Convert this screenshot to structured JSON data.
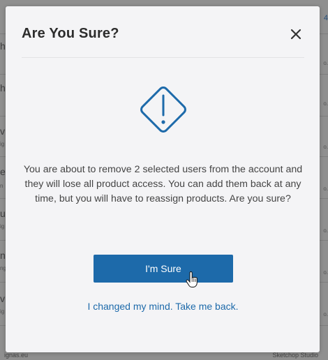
{
  "background": {
    "right_top_text": "4",
    "left_labels": [
      "h",
      "h",
      "v",
      "e",
      "u",
      "n",
      "v"
    ],
    "left_sublabels": [
      "",
      "",
      "ig",
      "n",
      "ig",
      "ng",
      "ig"
    ],
    "right_labels": [
      "o.",
      "o.",
      "o.",
      "o.",
      "o.",
      "o.",
      "o."
    ],
    "bottom_left": "ignas.eu",
    "bottom_right": "Sketchop Studio"
  },
  "modal": {
    "title": "Are You Sure?",
    "message": "You are about to remove 2 selected users from the account and they will lose all product access. You can add them back at any time, but you will have to reassign products. Are you sure?",
    "confirm_label": "I'm Sure",
    "cancel_label": "I changed my mind. Take me back."
  },
  "icons": {
    "close": "close-icon",
    "alert": "warning-diamond-icon",
    "cursor": "hand-pointer-icon"
  },
  "colors": {
    "accent": "#1d6aaa",
    "modal_bg": "#f4f4f6",
    "overlay": "#8f8f8f"
  }
}
